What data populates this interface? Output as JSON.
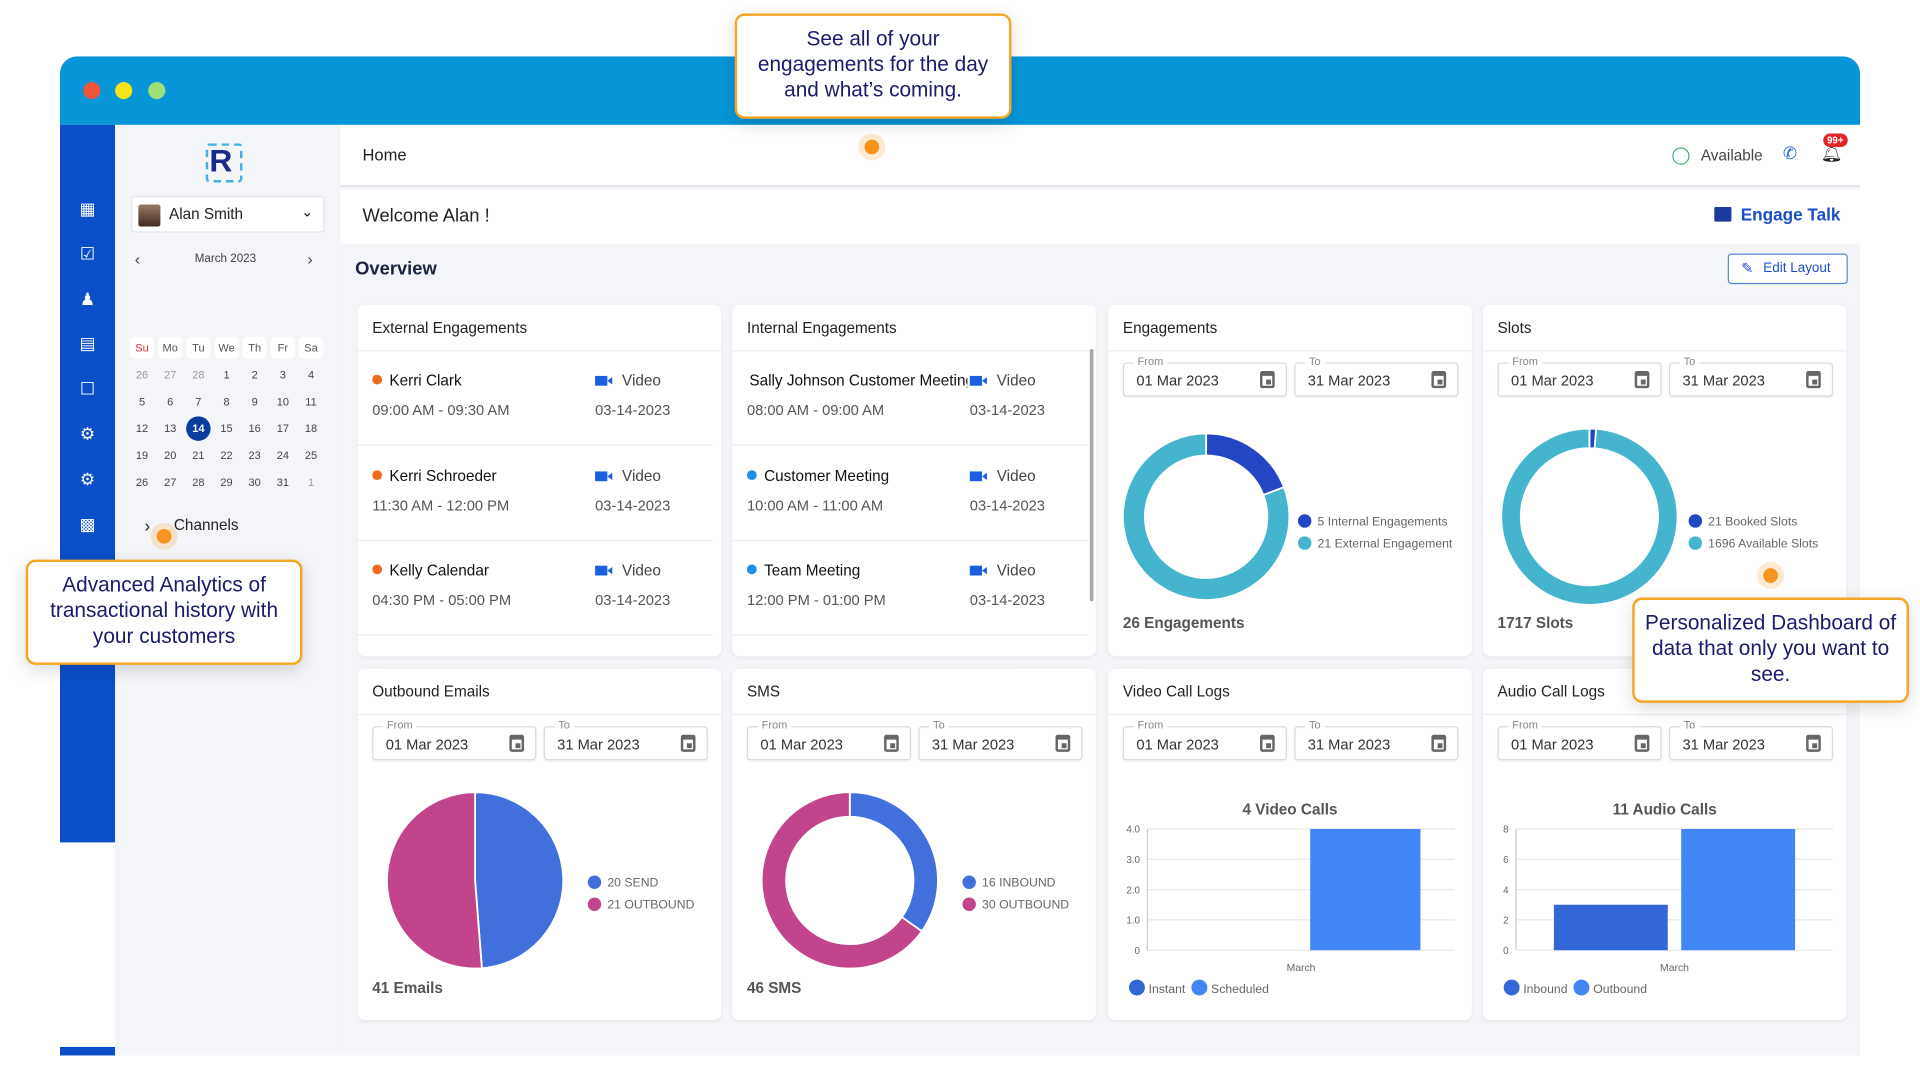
{
  "callouts": {
    "top": "See all of your engagements for the day and what’s coming.",
    "left": "Advanced Analytics of transactional history with your customers",
    "right": "Personalized Dashboard of data that only you want to see."
  },
  "colors": {
    "titlebar": "#0796d8",
    "rail": "#0a4fc8",
    "accent": "#0b3d9e",
    "callout_border": "#f6a623"
  },
  "rail_icons": [
    "dashboard-icon",
    "calendar-check-icon",
    "users-icon",
    "calendar-icon",
    "clipboard-check-icon",
    "user-settings-icon",
    "settings-icon",
    "report-icon"
  ],
  "sidebar": {
    "logo": "R",
    "user": "Alan Smith",
    "calendar": {
      "month": "March 2023",
      "weekdays": [
        "Su",
        "Mo",
        "Tu",
        "We",
        "Th",
        "Fr",
        "Sa"
      ],
      "weeks": [
        [
          "26",
          "27",
          "28",
          "1",
          "2",
          "3",
          "4"
        ],
        [
          "5",
          "6",
          "7",
          "8",
          "9",
          "10",
          "11"
        ],
        [
          "12",
          "13",
          "14",
          "15",
          "16",
          "17",
          "18"
        ],
        [
          "19",
          "20",
          "21",
          "22",
          "23",
          "24",
          "25"
        ],
        [
          "26",
          "27",
          "28",
          "29",
          "30",
          "31",
          "1"
        ]
      ],
      "selected": "14"
    },
    "channels": "Channels"
  },
  "header": {
    "title": "Home",
    "status": "Available",
    "badge": "99+"
  },
  "welcome": {
    "text": "Welcome Alan !",
    "engage_talk": "Engage Talk"
  },
  "overview": {
    "title": "Overview",
    "edit_layout": "Edit Layout"
  },
  "external": {
    "title": "External Engagements",
    "items": [
      {
        "name": "Kerri Clark",
        "time": "09:00 AM - 09:30 AM",
        "type": "Video",
        "date": "03-14-2023",
        "color": "#f26b1d"
      },
      {
        "name": "Kerri Schroeder",
        "time": "11:30 AM - 12:00 PM",
        "type": "Video",
        "date": "03-14-2023",
        "color": "#f26b1d"
      },
      {
        "name": "Kelly Calendar",
        "time": "04:30 PM - 05:00 PM",
        "type": "Video",
        "date": "03-14-2023",
        "color": "#f26b1d"
      }
    ]
  },
  "internal": {
    "title": "Internal Engagements",
    "items": [
      {
        "name": "Sally Johnson Customer Meeting",
        "time": "08:00 AM - 09:00 AM",
        "type": "Video",
        "date": "03-14-2023",
        "color": ""
      },
      {
        "name": "Customer Meeting",
        "time": "10:00 AM - 11:00 AM",
        "type": "Video",
        "date": "03-14-2023",
        "color": "#1e8fe8"
      },
      {
        "name": "Team Meeting",
        "time": "12:00 PM - 01:00 PM",
        "type": "Video",
        "date": "03-14-2023",
        "color": "#1e8fe8"
      }
    ]
  },
  "date_range": {
    "from_label": "From",
    "to_label": "To",
    "from": "01 Mar 2023",
    "to": "31 Mar 2023"
  },
  "chart_data": [
    {
      "id": "engagements",
      "card_title": "Engagements",
      "type": "pie",
      "donut": true,
      "total": "26 Engagements",
      "slices": [
        {
          "label": "5 Internal Engagements",
          "value": 5,
          "color": "#2346c4"
        },
        {
          "label": "21 External Engagement",
          "value": 21,
          "color": "#45b5cf"
        }
      ]
    },
    {
      "id": "slots",
      "card_title": "Slots",
      "type": "pie",
      "donut": true,
      "total": "1717 Slots",
      "slices": [
        {
          "label": "21 Booked Slots",
          "value": 21,
          "color": "#2346c4"
        },
        {
          "label": "1696 Available Slots",
          "value": 1696,
          "color": "#45b5cf"
        }
      ]
    },
    {
      "id": "emails",
      "card_title": "Outbound Emails",
      "type": "pie",
      "donut": false,
      "total": "41 Emails",
      "slices": [
        {
          "label": "20 SEND",
          "value": 20,
          "color": "#4170dd"
        },
        {
          "label": "21 OUTBOUND",
          "value": 21,
          "color": "#c2448a"
        }
      ]
    },
    {
      "id": "sms",
      "card_title": "SMS",
      "type": "pie",
      "donut": true,
      "total": "46 SMS",
      "slices": [
        {
          "label": "16 INBOUND",
          "value": 16,
          "color": "#4170dd"
        },
        {
          "label": "30 OUTBOUND",
          "value": 30,
          "color": "#c2448a"
        }
      ]
    },
    {
      "id": "video",
      "card_title": "Video Call Logs",
      "type": "bar",
      "title": "4 Video Calls",
      "categories": [
        "March"
      ],
      "yticks": [
        "0",
        "1.0",
        "2.0",
        "3.0",
        "4.0"
      ],
      "ylim": [
        0,
        4
      ],
      "grid": true,
      "legend": "bottom-left",
      "series": [
        {
          "name": "Instant",
          "values": [
            0
          ],
          "color": "#3366d6"
        },
        {
          "name": "Scheduled",
          "values": [
            4
          ],
          "color": "#4285f4"
        }
      ]
    },
    {
      "id": "audio",
      "card_title": "Audio Call Logs",
      "type": "bar",
      "title": "11 Audio Calls",
      "categories": [
        "March"
      ],
      "yticks": [
        "0",
        "2",
        "4",
        "6",
        "8"
      ],
      "ylim": [
        0,
        8
      ],
      "grid": true,
      "legend": "bottom-left",
      "series": [
        {
          "name": "Inbound",
          "values": [
            3
          ],
          "color": "#3366d6"
        },
        {
          "name": "Outbound",
          "values": [
            8
          ],
          "color": "#4285f4"
        }
      ]
    }
  ]
}
